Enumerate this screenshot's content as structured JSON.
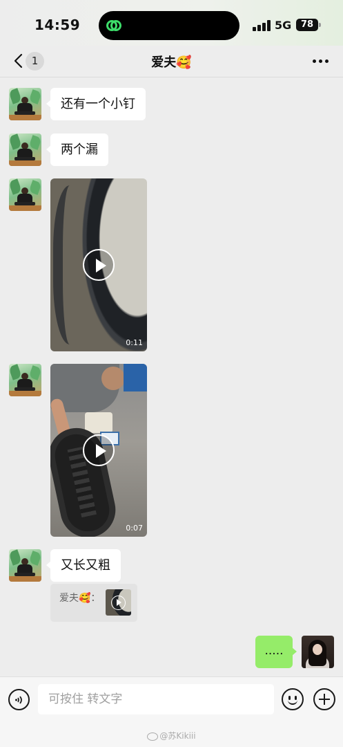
{
  "status_bar": {
    "time": "14:59",
    "network": "5G",
    "battery": "78"
  },
  "nav": {
    "unread_count": "1",
    "title": "爱夫🥰"
  },
  "messages": [
    {
      "text": "还有一个小钉"
    },
    {
      "text": "两个漏"
    },
    {
      "type": "video",
      "duration": "0:11"
    },
    {
      "type": "video",
      "duration": "0:07"
    },
    {
      "text": "又长又粗"
    },
    {
      "quote": "爱夫🥰："
    },
    {
      "text": "....."
    }
  ],
  "input": {
    "placeholder": "可按住 转文字"
  },
  "watermark": "@苏Kikiii",
  "icons": [
    "back-chevron-icon",
    "more-icon",
    "play-icon",
    "voice-icon",
    "emoji-icon",
    "plus-icon"
  ]
}
